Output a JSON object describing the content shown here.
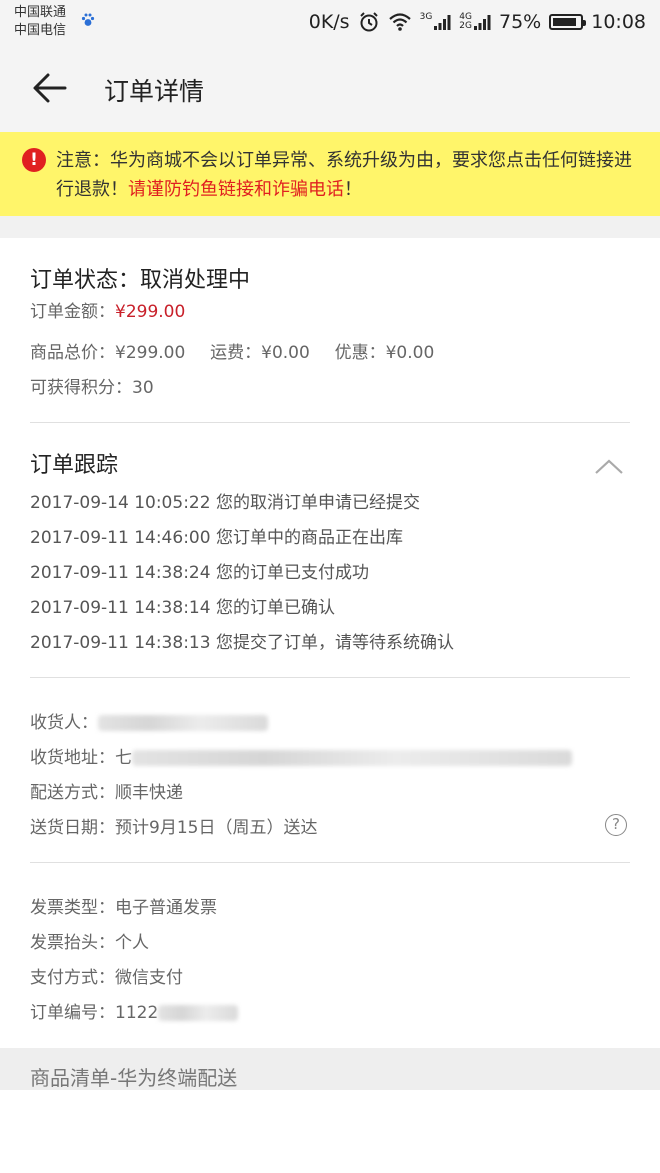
{
  "status_bar": {
    "carrier_1": "中国联通",
    "carrier_2": "中国电信",
    "net_speed": "0K/s",
    "network_3g": "3G",
    "network_4g": "4G",
    "network_2g": "2G",
    "battery_percent": "75%",
    "battery_level": 0.75,
    "time": "10:08",
    "icons": [
      "paw-icon",
      "alarm-icon",
      "wifi-icon",
      "signal-icon",
      "battery-icon"
    ]
  },
  "app_bar": {
    "title": "订单详情",
    "back_icon": "arrow-left-icon"
  },
  "notice": {
    "prefix": "注意：",
    "text": "华为商城不会以订单异常、系统升级为由，要求您点击任何链接进行退款！",
    "warning": "请谨防钓鱼链接和诈骗电话",
    "suffix": "！",
    "icon": "exclamation-icon",
    "color_bg": "#fff56a",
    "color_warn": "#e02020"
  },
  "order_status": {
    "title": "订单状态：取消处理中",
    "amount_label": "订单金额：",
    "amount_value": "¥299.00",
    "goods_total_label": "商品总价：",
    "goods_total_value": "¥299.00",
    "shipping_label": "运费：",
    "shipping_value": "¥0.00",
    "discount_label": "优惠：",
    "discount_value": "¥0.00",
    "points_label": "可获得积分：",
    "points_value": "30"
  },
  "tracking": {
    "title": "订单跟踪",
    "collapse_icon": "chevron-up-icon",
    "items": [
      {
        "time": "2017-09-14 10:05:22",
        "text": "您的取消订单申请已经提交"
      },
      {
        "time": "2017-09-11 14:46:00",
        "text": "您订单中的商品正在出库"
      },
      {
        "time": "2017-09-11 14:38:24",
        "text": "您的订单已支付成功"
      },
      {
        "time": "2017-09-11 14:38:14",
        "text": "您的订单已确认"
      },
      {
        "time": "2017-09-11 14:38:13",
        "text": "您提交了订单，请等待系统确认"
      }
    ]
  },
  "delivery": {
    "receiver_label": "收货人：",
    "address_label": "收货地址：",
    "address_value_visible": "七",
    "shipping_method_label": "配送方式：",
    "shipping_method_value": "顺丰快递",
    "delivery_date_label": "送货日期：",
    "delivery_date_value": "预计9月15日（周五）送达",
    "help_icon": "question-circle-icon",
    "help_text": "?"
  },
  "invoice": {
    "type_label": "发票类型：",
    "type_value": "电子普通发票",
    "header_label": "发票抬头：",
    "header_value": "个人",
    "payment_label": "支付方式：",
    "payment_value": "微信支付",
    "order_no_label": "订单编号：",
    "order_no_value_visible": "1122"
  },
  "goods_list": {
    "title": "商品清单-华为终端配送"
  }
}
